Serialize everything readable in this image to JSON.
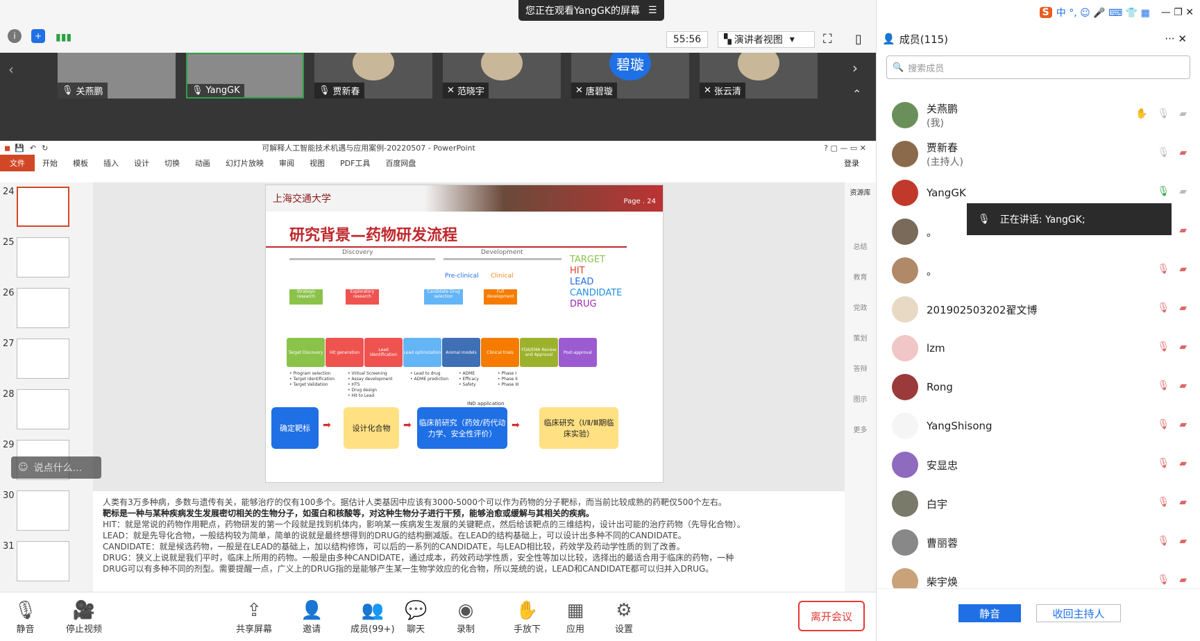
{
  "share_banner": {
    "text": "您正在观看YangGK的屏幕",
    "menu_icon": "menu-icon"
  },
  "top_toolbar": {
    "timer": "55:56",
    "view_mode": "演讲者视图"
  },
  "video_tiles": [
    {
      "name": "关燕鹏",
      "mic": "mic-on-icon"
    },
    {
      "name": "YangGK",
      "mic": "mic-on-icon"
    },
    {
      "name": "贾新春",
      "mic": "mic-on-icon"
    },
    {
      "name": "范晓宇",
      "mic": "mic-off-icon"
    },
    {
      "name": "唐碧璇",
      "mic": "mic-off-icon",
      "avatar_text": "碧璇"
    },
    {
      "name": "张云清",
      "mic": "mic-off-icon"
    }
  ],
  "ppt": {
    "title": "可解释人工智能技术机遇与应用案例-20220507 - PowerPoint",
    "ribbon": [
      "文件",
      "开始",
      "模板",
      "插入",
      "设计",
      "切换",
      "动画",
      "幻灯片放映",
      "审阅",
      "视图",
      "PDF工具",
      "百度网盘"
    ],
    "login": "登录",
    "slide_numbers": [
      "24",
      "25",
      "26",
      "27",
      "28",
      "29",
      "30",
      "31"
    ],
    "slide": {
      "header_logo": "上海交通大学",
      "page": "Page . 24",
      "heading": "研究背景—药物研发流程",
      "phase_discovery": "Discovery",
      "phase_development": "Development",
      "preclinical": "Pre-clinical",
      "clinical": "Clinical",
      "legend": [
        "TARGET",
        "HIT",
        "LEAD",
        "CANDIDATE",
        "DRUG"
      ],
      "top_boxes": [
        "Strategic research",
        "Exploratory research",
        "Candidate Drug selection",
        "Full development"
      ],
      "chevrons": [
        "Target Discovery",
        "Hit generation",
        "Lead identification",
        "Lead optimization",
        "Animal models",
        "Clinical trials",
        "FDA/EMA Review and Approval",
        "Post-approval"
      ],
      "bullets": [
        [
          "• Program selection",
          "• Target identification",
          "• Target Validation"
        ],
        [
          "• Virtual Screening",
          "• Assay development",
          "• HTS",
          "• Drug design",
          "• Hit to Lead"
        ],
        [
          "• Lead to drug",
          "• ADME prediction"
        ],
        [
          "• ADME",
          "• Efficacy",
          "• Safety"
        ],
        [
          "• Phase I",
          "• Phase II",
          "• Phase III"
        ]
      ],
      "ind": "IND application",
      "bottom": [
        "确定靶标",
        "设计化合物",
        "临床前研究（药效/药代动力学、安全性评价）",
        "临床研究（Ⅰ/Ⅱ/Ⅲ期临床实验）"
      ]
    },
    "notes": [
      "人类有3万多种病，多数与遗传有关，能够治疗的仅有100多个。据估计人类基因中应该有3000-5000个可以作为药物的分子靶标，而当前比较成熟的药靶仅500个左右。",
      "靶标是一种与某种疾病发生发展密切相关的生物分子，如蛋白和核酸等，对这种生物分子进行干预，能够治愈或缓解与其相关的疾病。",
      "HIT：就是常说的药物作用靶点，药物研发的第一个段就是找到机体内，影响某一疾病发生发展的关键靶点，然后给该靶点的三维结构，设计出可能的治疗药物（先导化合物）。",
      "LEAD：就是先导化合物，一般结构较为简单，简单的说就是最终想得到的DRUG的结构删减版。在LEAD的结构基础上，可以设计出多种不同的CANDIDATE。",
      "CANDIDATE：就是候选药物，一般是在LEAD的基础上，加以结构修饰，可以后的一系列的CANDIDATE，与LEAD相比较，药效学及药动学性质的到了改善。",
      "DRUG：狭义上说就是我们平时，临床上所用的药物。一般是由多种CANDIDATE，通过成本，药效药动学性质，安全性等加以比较，选择出的最适合用于临床的药物，一种",
      "DRUG可以有多种不同的剂型。需要提醒一点，广义上的DRUG指的是能够产生某一生物学效应的化合物，所以笼统的说，LEAD和CANDIDATE都可以归并入DRUG。"
    ],
    "side_panel": [
      "资源库",
      "总结",
      "教育",
      "党政",
      "策划",
      "答辩",
      "图示",
      "更多"
    ],
    "chat_placeholder": "说点什么..."
  },
  "bottom_toolbar": [
    {
      "label": "静音",
      "icon": "mic-icon"
    },
    {
      "label": "停止视频",
      "icon": "camera-icon"
    },
    {
      "label": "共享屏幕",
      "icon": "share-screen-icon"
    },
    {
      "label": "邀请",
      "icon": "invite-icon"
    },
    {
      "label": "成员(99+)",
      "icon": "members-icon"
    },
    {
      "label": "聊天",
      "icon": "chat-icon"
    },
    {
      "label": "录制",
      "icon": "record-icon"
    },
    {
      "label": "手放下",
      "icon": "hand-icon"
    },
    {
      "label": "应用",
      "icon": "apps-icon"
    },
    {
      "label": "设置",
      "icon": "gear-icon"
    }
  ],
  "leave_label": "离开会议",
  "members_panel": {
    "title": "成员(115)",
    "search_placeholder": "搜索成员",
    "speaking": "正在讲话: YangGK;",
    "members": [
      {
        "name": "关燕鹏",
        "sub": "(我)"
      },
      {
        "name": "贾新春",
        "sub": "(主持人)"
      },
      {
        "name": "YangGK",
        "sub": ""
      },
      {
        "name": "。",
        "sub": ""
      },
      {
        "name": "。",
        "sub": ""
      },
      {
        "name": "201902503202翟文博",
        "sub": ""
      },
      {
        "name": "lzm",
        "sub": ""
      },
      {
        "name": "Rong",
        "sub": ""
      },
      {
        "name": "YangShisong",
        "sub": ""
      },
      {
        "name": "安显忠",
        "sub": ""
      },
      {
        "name": "白宇",
        "sub": ""
      },
      {
        "name": "曹丽蓉",
        "sub": ""
      },
      {
        "name": "柴宇焕",
        "sub": ""
      }
    ],
    "mute_all": "静音",
    "reclaim_host": "收回主持人"
  },
  "colors": {
    "accent": "#1f6fe5",
    "ppt_red": "#d24726",
    "leave": "#e53935"
  }
}
